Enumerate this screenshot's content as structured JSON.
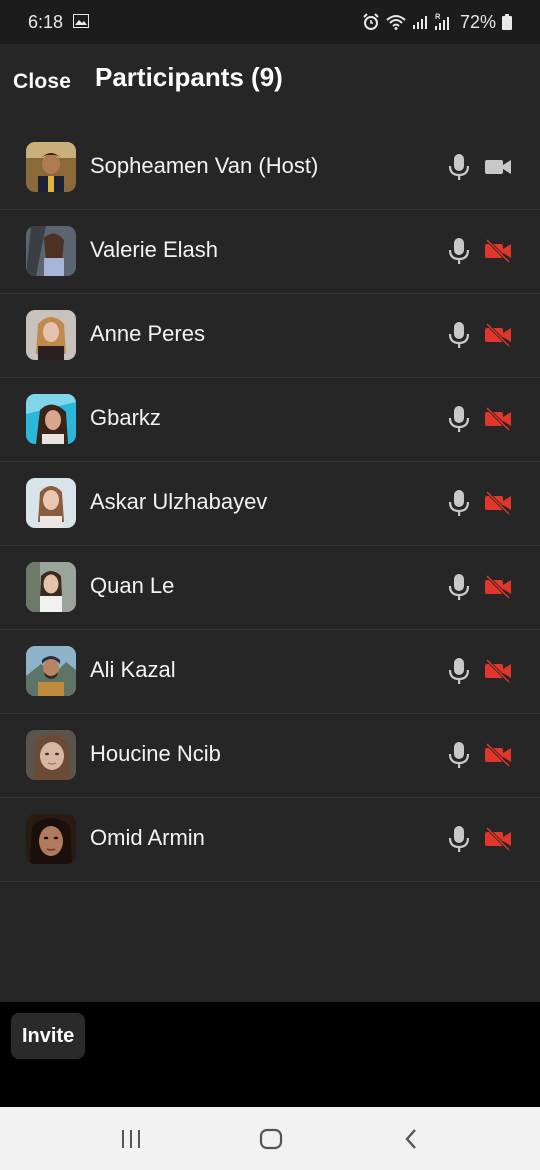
{
  "status_bar": {
    "time": "6:18",
    "battery": "72%",
    "icons": [
      "gallery-icon",
      "alarm-icon",
      "wifi-icon",
      "signal-icon",
      "signal-r-icon",
      "battery-icon"
    ]
  },
  "header": {
    "close_label": "Close",
    "title": "Participants (9)"
  },
  "participants": [
    {
      "name": "Sopheamen Van (Host)",
      "mic": "on",
      "video": "on"
    },
    {
      "name": "Valerie Elash",
      "mic": "on",
      "video": "off"
    },
    {
      "name": "Anne Peres",
      "mic": "on",
      "video": "off"
    },
    {
      "name": "Gbarkz",
      "mic": "on",
      "video": "off"
    },
    {
      "name": "Askar Ulzhabayev",
      "mic": "on",
      "video": "off"
    },
    {
      "name": "Quan Le",
      "mic": "on",
      "video": "off"
    },
    {
      "name": "Ali Kazal",
      "mic": "on",
      "video": "off"
    },
    {
      "name": "Houcine Ncib",
      "mic": "on",
      "video": "off"
    },
    {
      "name": "Omid Armin",
      "mic": "on",
      "video": "off"
    }
  ],
  "footer": {
    "invite_label": "Invite"
  },
  "colors": {
    "background": "#262626",
    "video_off": "#e0362b",
    "icon_grey": "#c8c8c8"
  }
}
